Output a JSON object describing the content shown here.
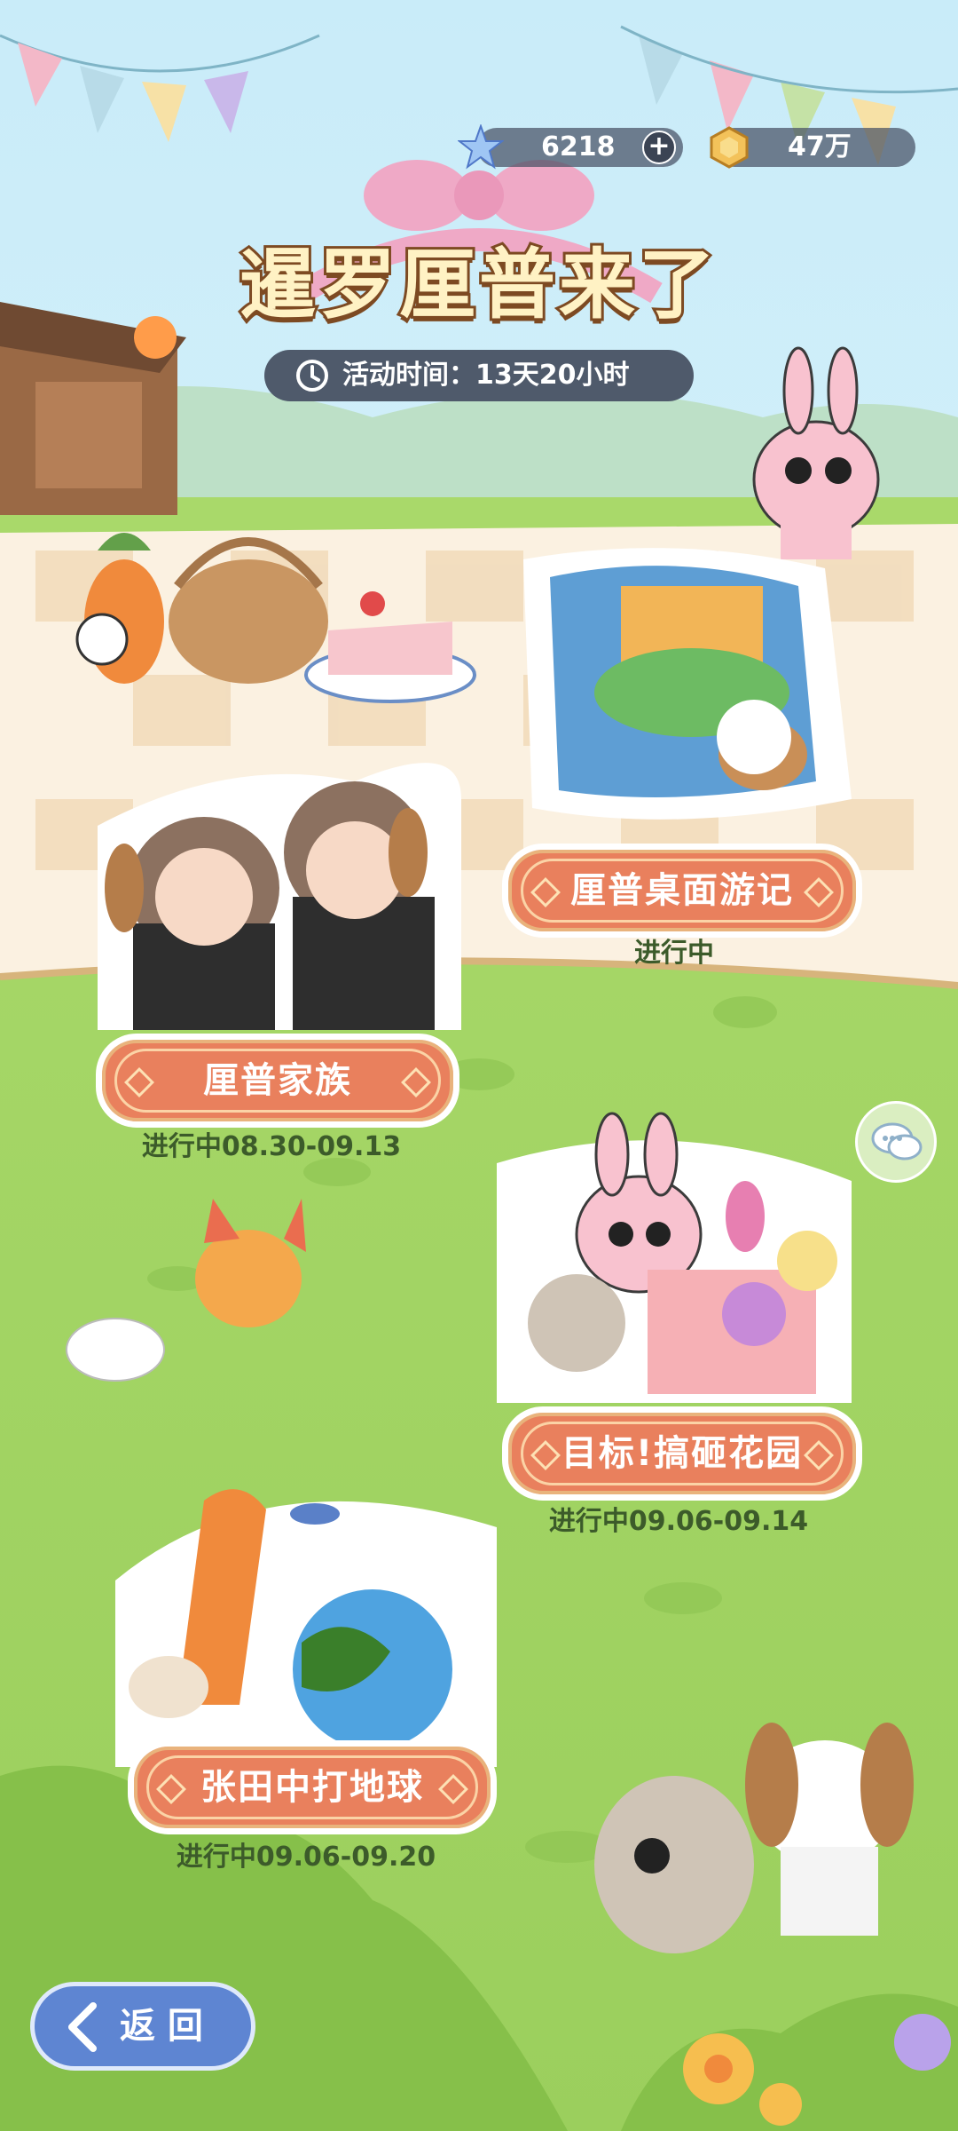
{
  "resources": {
    "star_value": "6218",
    "coin_value": "47万"
  },
  "event": {
    "title": "暹罗厘普来了",
    "timer_label": "活动时间：13天20小时"
  },
  "activities": [
    {
      "name": "厘普桌面游记",
      "status": "进行中"
    },
    {
      "name": "厘普家族",
      "status": "进行中08.30-09.13"
    },
    {
      "name": "目标!搞砸花园",
      "status": "进行中09.06-09.14"
    },
    {
      "name": "张田中打地球",
      "status": "进行中09.06-09.20"
    }
  ],
  "back_button": "返 回",
  "icons": [
    "star-icon",
    "plus-icon",
    "coin-icon",
    "clock-icon",
    "chat-icon",
    "back-arrow-icon"
  ],
  "colors": {
    "banner": "#e9805d",
    "timer": "#4f5a6b",
    "back": "#5e85d2"
  }
}
